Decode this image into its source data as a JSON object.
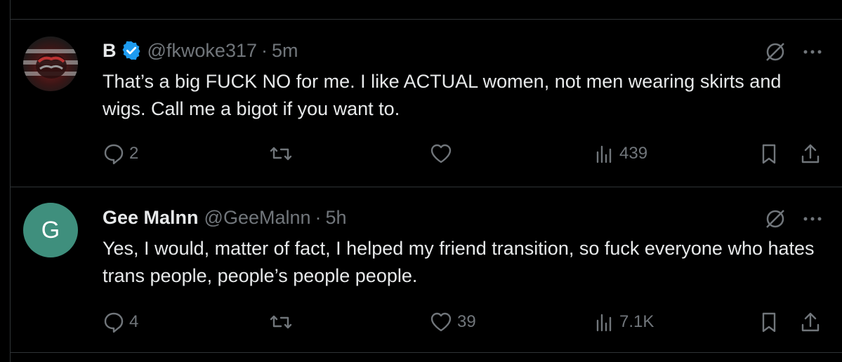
{
  "posts": [
    {
      "name": "B",
      "verified": true,
      "handle": "@fkwoke317",
      "separator": "·",
      "time": "5m",
      "text": "That’s a big FUCK NO for me. I like ACTUAL women, not men wearing skirts and wigs. Call me a bigot if you want to.",
      "replies": "2",
      "reposts": "",
      "likes": "",
      "views": "439",
      "avatar": "fist-photo"
    },
    {
      "name": "Gee Malnn",
      "verified": false,
      "handle": "@GeeMalnn",
      "separator": "·",
      "time": "5h",
      "text": "Yes, I would, matter of fact, I helped my friend transition, so fuck everyone who hates trans people, people’s people people.",
      "replies": "4",
      "reposts": "",
      "likes": "39",
      "views": "7.1K",
      "avatar_letter": "G"
    }
  ],
  "colors": {
    "background": "#000000",
    "text": "#e7e9ea",
    "muted": "#71767b",
    "verified": "#1d9bf0",
    "avatar_g": "#3f8f7d",
    "divider": "#2f3336"
  }
}
